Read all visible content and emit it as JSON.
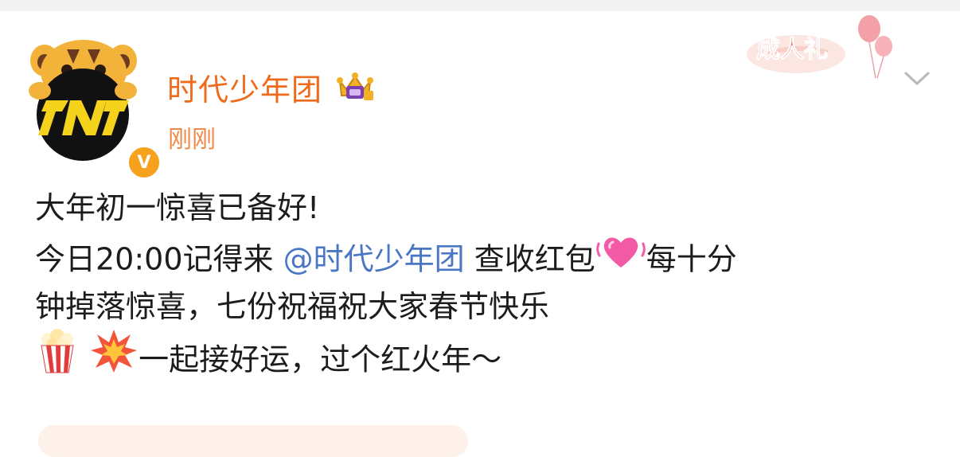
{
  "post": {
    "username": "时代少年团",
    "timestamp": "刚刚",
    "verified_mark": "V",
    "avatar_text": "TNT",
    "event_badge_text": "成人礼",
    "content": {
      "line1": "大年初一惊喜已备好!",
      "line2_prefix": "今日20:00记得来 ",
      "mention": "@时代少年团",
      "line2_middle": " 查收红包",
      "line2_suffix": "每十分",
      "line3": "钟掉落惊喜，七份祝福祝大家春节快乐",
      "line4_text": "一起接好运，过个红火年～"
    },
    "icons": {
      "verified": "verified-badge-icon",
      "crown": "crown-badge-icon",
      "heart": "vibrating-heart-icon",
      "popcorn": "popcorn-icon",
      "collision": "collision-icon",
      "dropdown": "chevron-down-icon",
      "balloons": "balloons-icon"
    },
    "colors": {
      "username": "#f06a1c",
      "mention": "#4a76c6",
      "verified": "#f6a21e",
      "body_text": "#1c1c1c"
    }
  }
}
